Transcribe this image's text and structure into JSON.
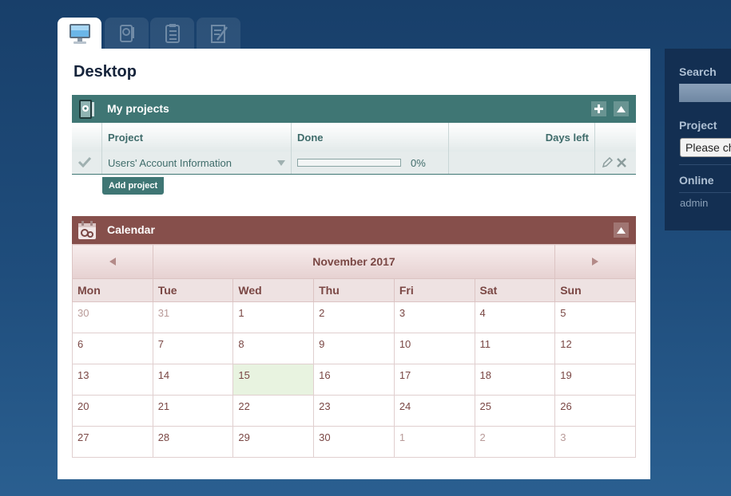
{
  "tabs": [
    {
      "icon": "desktop-icon",
      "active": true
    },
    {
      "icon": "projects-icon",
      "active": false
    },
    {
      "icon": "tasks-icon",
      "active": false
    },
    {
      "icon": "notes-icon",
      "active": false
    }
  ],
  "page_title": "Desktop",
  "projects_widget": {
    "title": "My projects",
    "icon": "projects-widget-icon",
    "columns": [
      "Project",
      "Done",
      "Days left"
    ],
    "rows": [
      {
        "project": "Users' Account Information",
        "done_percent": 0,
        "done_label": "0%",
        "days_left": ""
      }
    ],
    "add_label": "Add project"
  },
  "calendar_widget": {
    "title": "Calendar",
    "icon": "calendar-widget-icon",
    "month_label": "November 2017",
    "prev_icon": "triangle-left-icon",
    "next_icon": "triangle-right-icon",
    "weekdays": [
      "Mon",
      "Tue",
      "Wed",
      "Thu",
      "Fri",
      "Sat",
      "Sun"
    ],
    "weeks": [
      [
        "30",
        "31",
        "1",
        "2",
        "3",
        "4",
        "5"
      ],
      [
        "6",
        "7",
        "8",
        "9",
        "10",
        "11",
        "12"
      ],
      [
        "13",
        "14",
        "15",
        "16",
        "17",
        "18",
        "19"
      ],
      [
        "20",
        "21",
        "22",
        "23",
        "24",
        "25",
        "26"
      ],
      [
        "27",
        "28",
        "29",
        "30",
        "1",
        "2",
        "3"
      ]
    ],
    "today": "15"
  },
  "sidebar": {
    "search_label": "Search",
    "project_label": "Project",
    "project_select": "Please ch",
    "online_label": "Online",
    "online_user": "admin"
  },
  "colors": {
    "background": "#1f4d7c",
    "projects_accent": "#3f7674",
    "calendar_accent": "#864f4b",
    "sidebar": "#132f52",
    "today": "#e8f3e0"
  }
}
